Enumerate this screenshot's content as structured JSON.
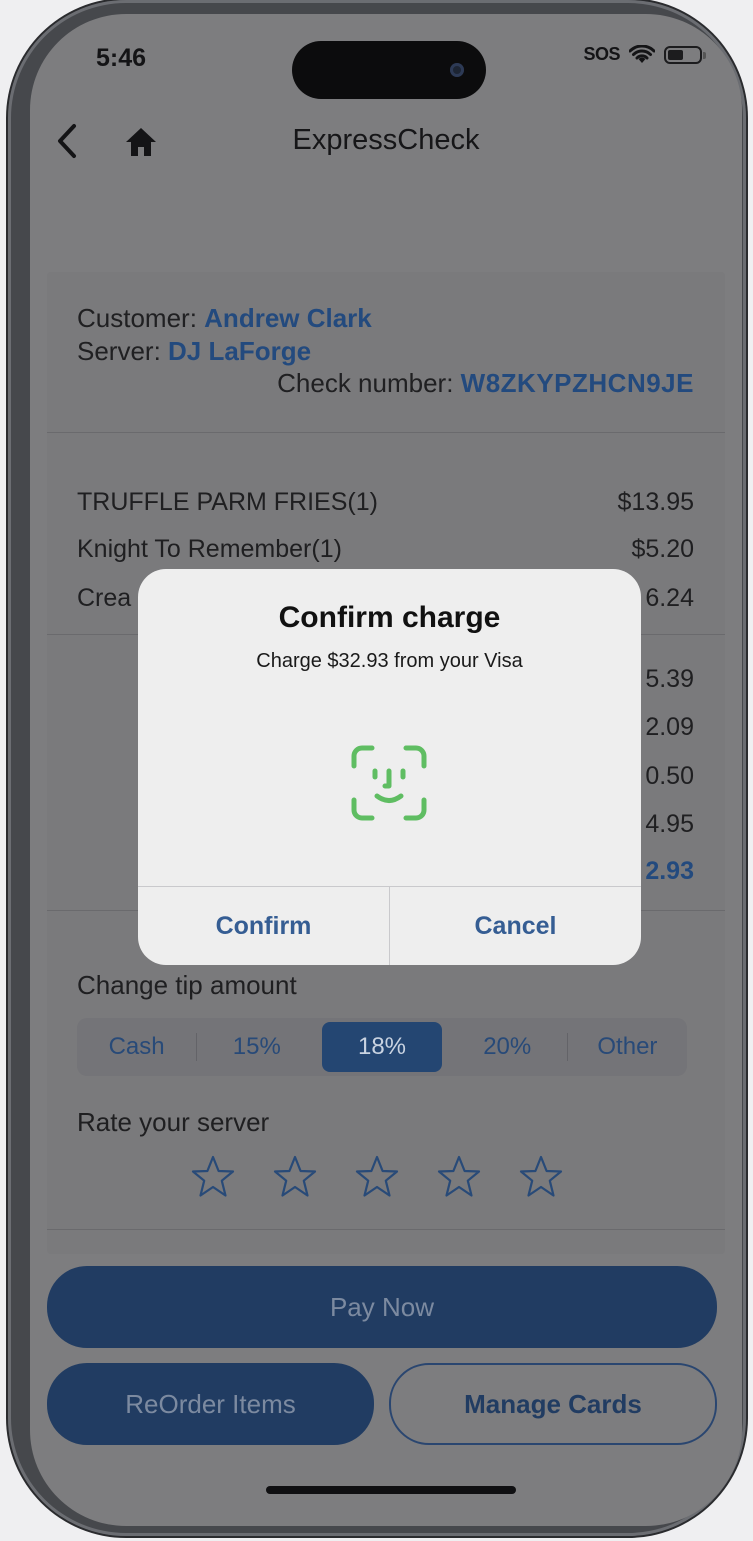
{
  "status": {
    "time": "5:46",
    "sos": "SOS"
  },
  "nav": {
    "title": "ExpressCheck"
  },
  "check": {
    "customer_label": "Customer: ",
    "customer_name": "Andrew Clark",
    "server_label": "Server: ",
    "server_name": "DJ LaForge",
    "check_label": "Check number: ",
    "check_number": "W8ZKYPZHCN9JE"
  },
  "items": [
    {
      "name": "TRUFFLE PARM FRIES(1)",
      "amount": "$13.95"
    },
    {
      "name": "Knight To Remember(1)",
      "amount": "$5.20"
    },
    {
      "name": "Crea",
      "amount": "6.24"
    }
  ],
  "totals": [
    {
      "amount": "5.39"
    },
    {
      "amount": "2.09"
    },
    {
      "amount": "0.50"
    },
    {
      "amount": "4.95"
    },
    {
      "amount": "2.93"
    }
  ],
  "tip": {
    "label": "Change tip amount",
    "options": [
      "Cash",
      "15%",
      "18%",
      "20%",
      "Other"
    ],
    "selected": "18%"
  },
  "rating": {
    "label": "Rate your server",
    "stars": 5,
    "value": 0
  },
  "buttons": {
    "pay": "Pay Now",
    "reorder": "ReOrder Items",
    "manage": "Manage Cards"
  },
  "modal": {
    "title": "Confirm charge",
    "message": "Charge $32.93 from your Visa",
    "confirm": "Confirm",
    "cancel": "Cancel",
    "icon": "face-id-icon",
    "icon_color": "#5fbd62"
  },
  "colors": {
    "accent": "#234a7e",
    "button": "#213c62"
  }
}
